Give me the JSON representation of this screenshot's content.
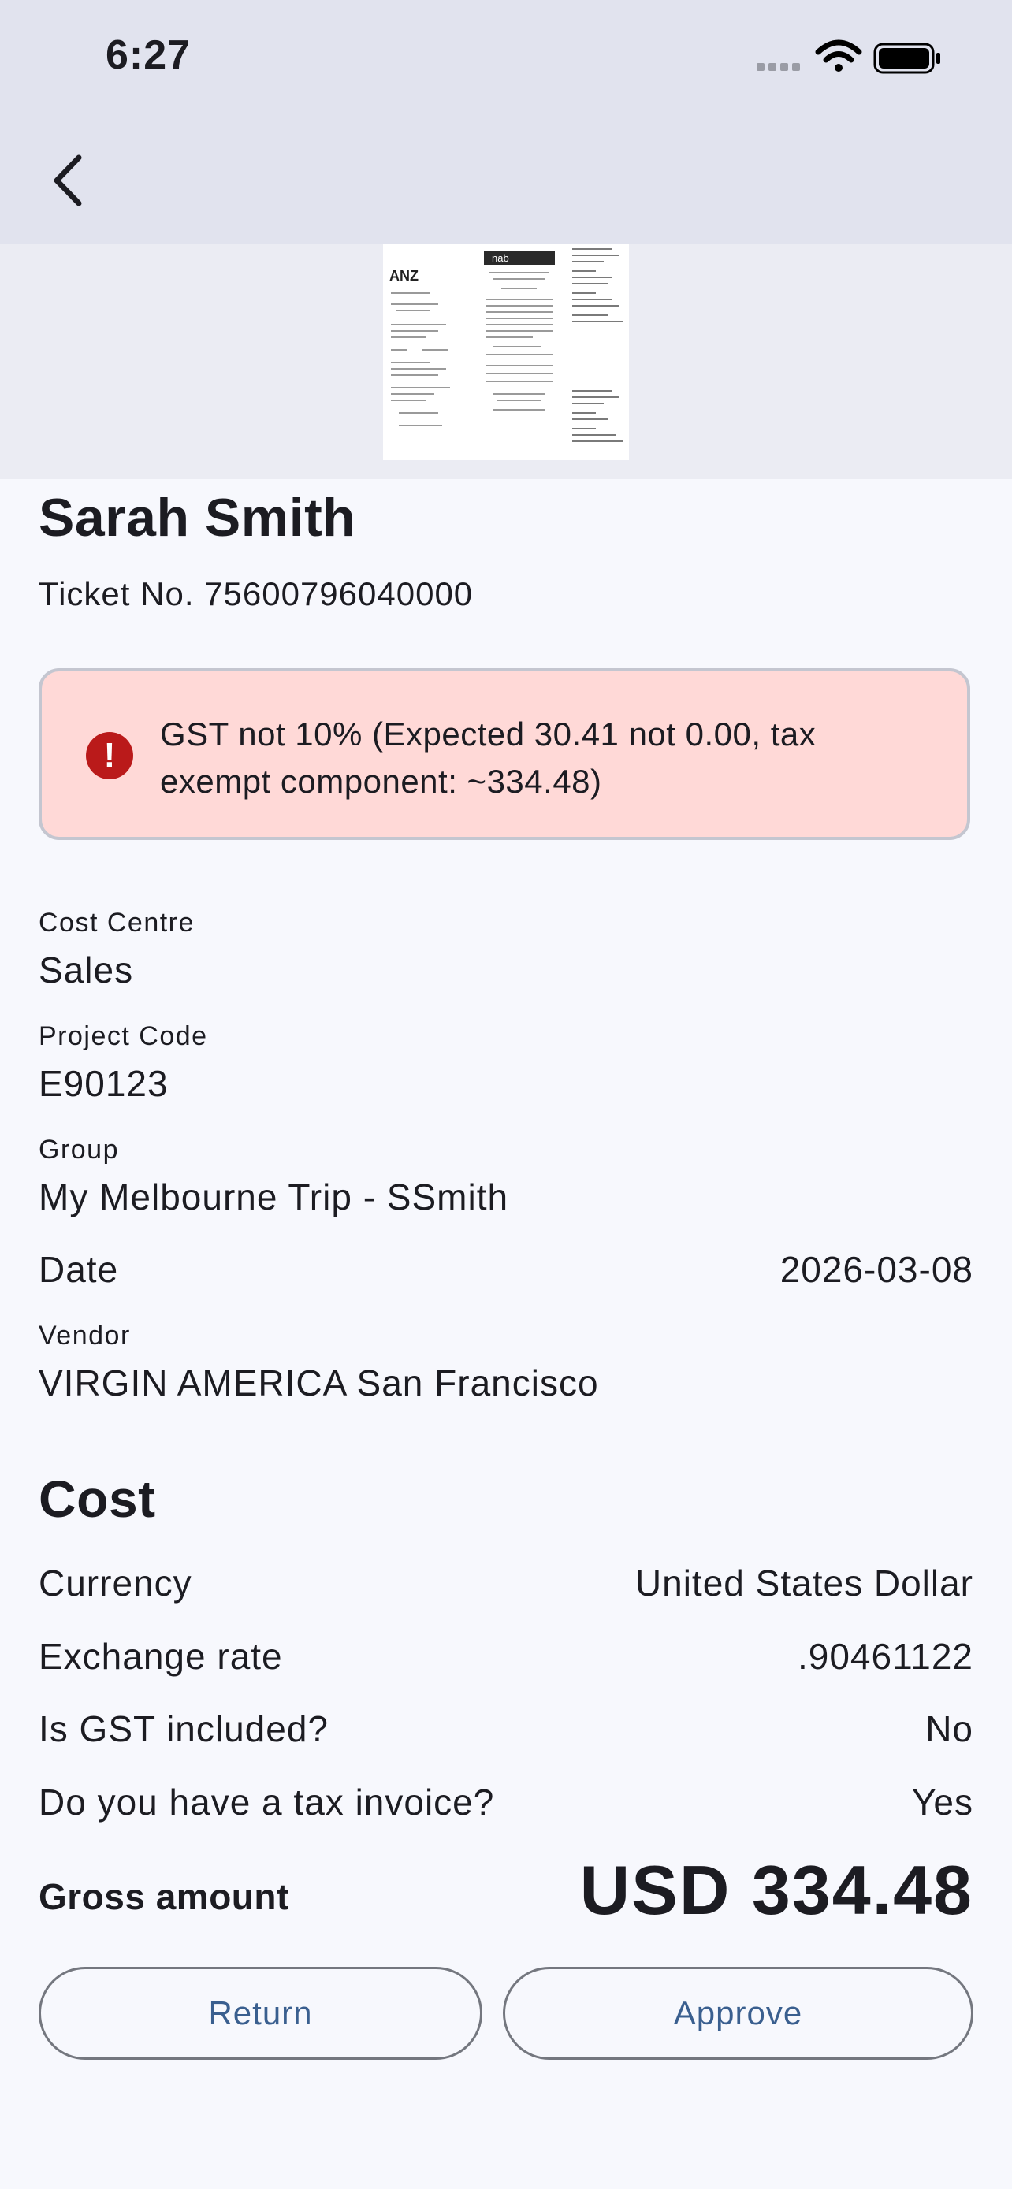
{
  "status_bar": {
    "time": "6:27"
  },
  "icons": {
    "back": "chevron-left-icon",
    "signal": "cellular-signal-icon",
    "wifi": "wifi-icon",
    "battery": "battery-icon",
    "alert": "error-circle-icon"
  },
  "receipt": {
    "bank_labels": [
      "ANZ",
      "nab"
    ]
  },
  "claim": {
    "name": "Sarah Smith",
    "ticket": "Ticket No. 75600796040000",
    "alert_message": "GST not 10% (Expected 30.41 not 0.00, tax exempt component: ~334.48)",
    "fields": {
      "cost_centre_label": "Cost Centre",
      "cost_centre_value": "Sales",
      "project_code_label": "Project Code",
      "project_code_value": "E90123",
      "group_label": "Group",
      "group_value": "My Melbourne Trip - SSmith",
      "date_label": "Date",
      "date_value": "2026-03-08",
      "vendor_label": "Vendor",
      "vendor_value": "VIRGIN AMERICA San Francisco"
    }
  },
  "cost": {
    "title": "Cost",
    "currency_label": "Currency",
    "currency_value": "United States Dollar",
    "exchange_rate_label": "Exchange rate",
    "exchange_rate_value": ".90461122",
    "gst_included_label": "Is GST included?",
    "gst_included_value": "No",
    "tax_invoice_label": "Do you have a tax invoice?",
    "tax_invoice_value": "Yes",
    "gross_amount_label": "Gross amount",
    "gross_amount_value": "USD 334.48"
  },
  "actions": {
    "return_label": "Return",
    "approve_label": "Approve"
  },
  "colors": {
    "app_bar": "#e1e3ee",
    "background": "#f7f8fd",
    "alert_background": "#ffd9d7",
    "alert_icon": "#ba1a1a",
    "button_text": "#3a5f8f"
  }
}
